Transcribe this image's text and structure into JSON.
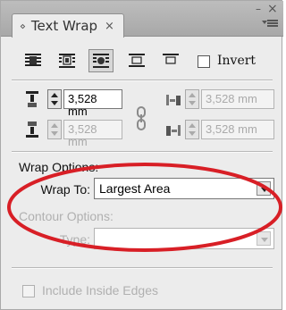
{
  "panel": {
    "tab_title": "Text Wrap",
    "tab_grip_icon": "panel-grip-icon",
    "tab_close": "×",
    "minimize": "–",
    "close": "×"
  },
  "wrap_modes": {
    "items": [
      {
        "name": "no-text-wrap",
        "icon": "no-wrap-icon",
        "selected": false
      },
      {
        "name": "wrap-around-bounding-box",
        "icon": "bounding-box-wrap-icon",
        "selected": false
      },
      {
        "name": "wrap-around-object-shape",
        "icon": "object-shape-wrap-icon",
        "selected": true
      },
      {
        "name": "jump-object",
        "icon": "jump-object-icon",
        "selected": false
      },
      {
        "name": "jump-to-next-column",
        "icon": "jump-next-column-icon",
        "selected": false
      }
    ],
    "invert_label": "Invert",
    "invert_checked": false
  },
  "offsets": {
    "top": "3,528 mm",
    "bottom": "3,528 mm",
    "left": "3,528 mm",
    "right": "3,528 mm"
  },
  "wrap_options": {
    "title": "Wrap Options:",
    "wrap_to_label": "Wrap To:",
    "wrap_to_value": "Largest Area"
  },
  "contour_options": {
    "title": "Contour Options:",
    "type_label": "Type:",
    "type_value": ""
  },
  "include_inside_edges": {
    "label": "Include Inside Edges",
    "checked": false
  },
  "colors": {
    "annotation_ellipse": "#d81f26",
    "disabled_text": "#b0b0b0"
  }
}
